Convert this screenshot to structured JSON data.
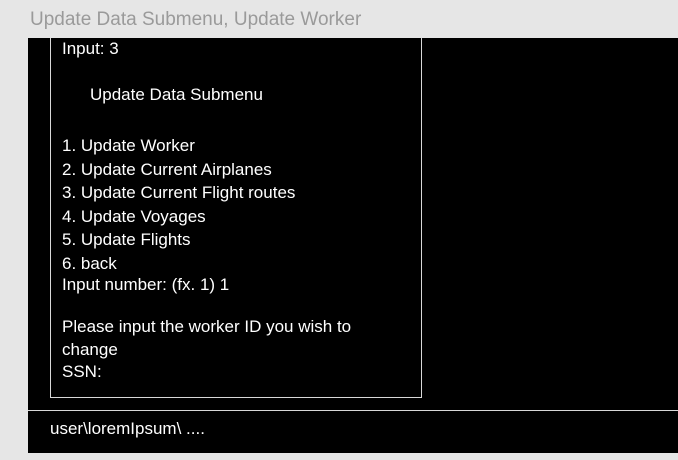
{
  "window": {
    "title": "Update Data Submenu, Update Worker"
  },
  "console": {
    "input_echo": "Input: 3",
    "menu_heading": "Update Data Submenu",
    "menu_items": [
      "1. Update Worker",
      "2. Update Current Airplanes",
      "3. Update Current Flight routes",
      "4. Update Voyages",
      "5. Update Flights",
      "6. back"
    ],
    "input_number_prompt": "Input number: (fx. 1) 1",
    "worker_prompt_line1": "Please input the worker ID you wish to",
    "worker_prompt_line2": "change",
    "ssn_prompt": "SSN:"
  },
  "status_bar": {
    "path": "user\\loremIpsum\\ ...."
  },
  "colors": {
    "page_background": "#e6e6e6",
    "terminal_background": "#000000",
    "terminal_text": "#ffffff",
    "border": "#d8d8d8",
    "title_text": "#9a9a9a"
  }
}
